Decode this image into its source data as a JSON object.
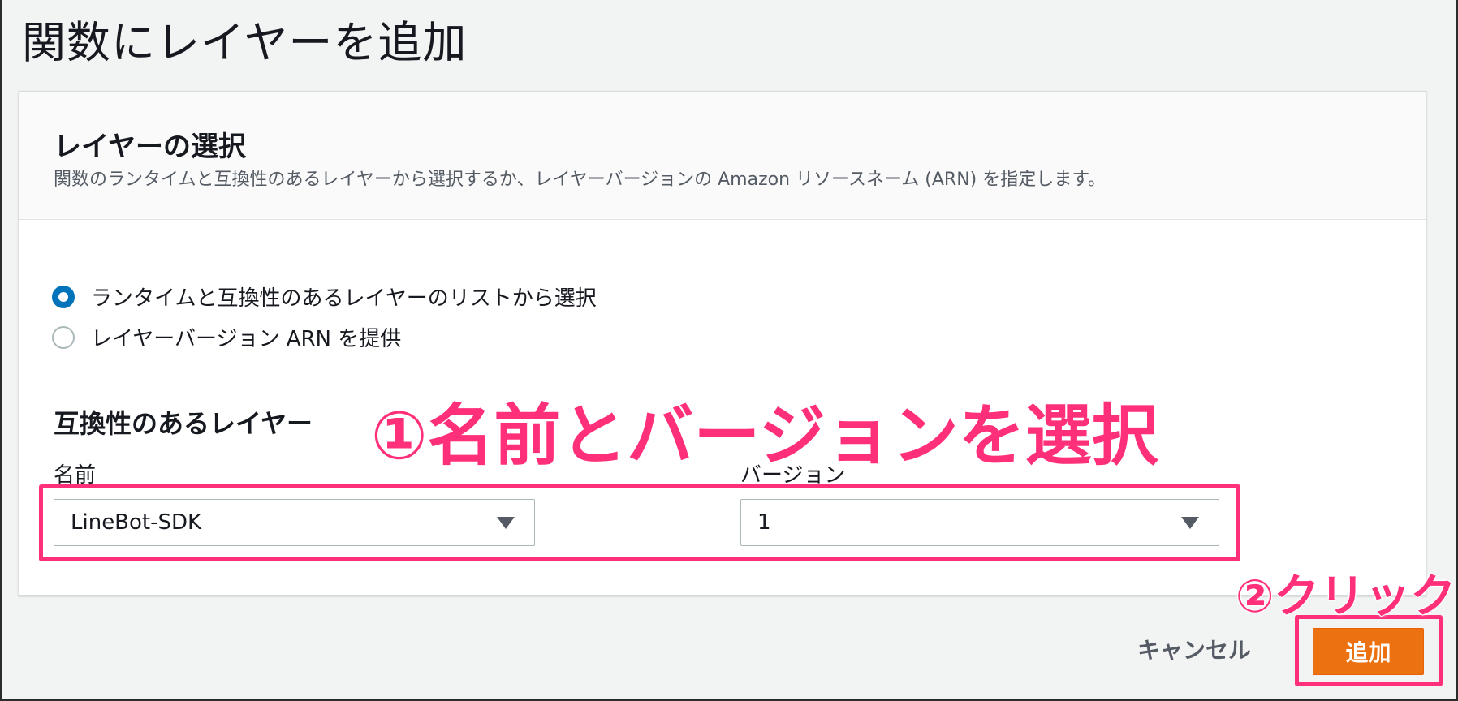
{
  "page": {
    "title": "関数にレイヤーを追加"
  },
  "layer_selection": {
    "title": "レイヤーの選択",
    "description": "関数のランタイムと互換性のあるレイヤーから選択するか、レイヤーバージョンの Amazon リソースネーム (ARN) を指定します。",
    "options": [
      {
        "label": "ランタイムと互換性のあるレイヤーのリストから選択",
        "selected": true
      },
      {
        "label": "レイヤーバージョン ARN を提供",
        "selected": false
      }
    ]
  },
  "compatible_layers": {
    "title": "互換性のあるレイヤー",
    "name_label": "名前",
    "name_value": "LineBot-SDK",
    "version_label": "バージョン",
    "version_value": "1"
  },
  "annotations": {
    "step1": "①名前とバージョンを選択",
    "step2": "②クリック",
    "color": "#ff2f7a"
  },
  "footer": {
    "cancel_label": "キャンセル",
    "add_label": "追加"
  },
  "colors": {
    "primary_button": "#ec7211",
    "radio_selected": "#0073bb"
  }
}
